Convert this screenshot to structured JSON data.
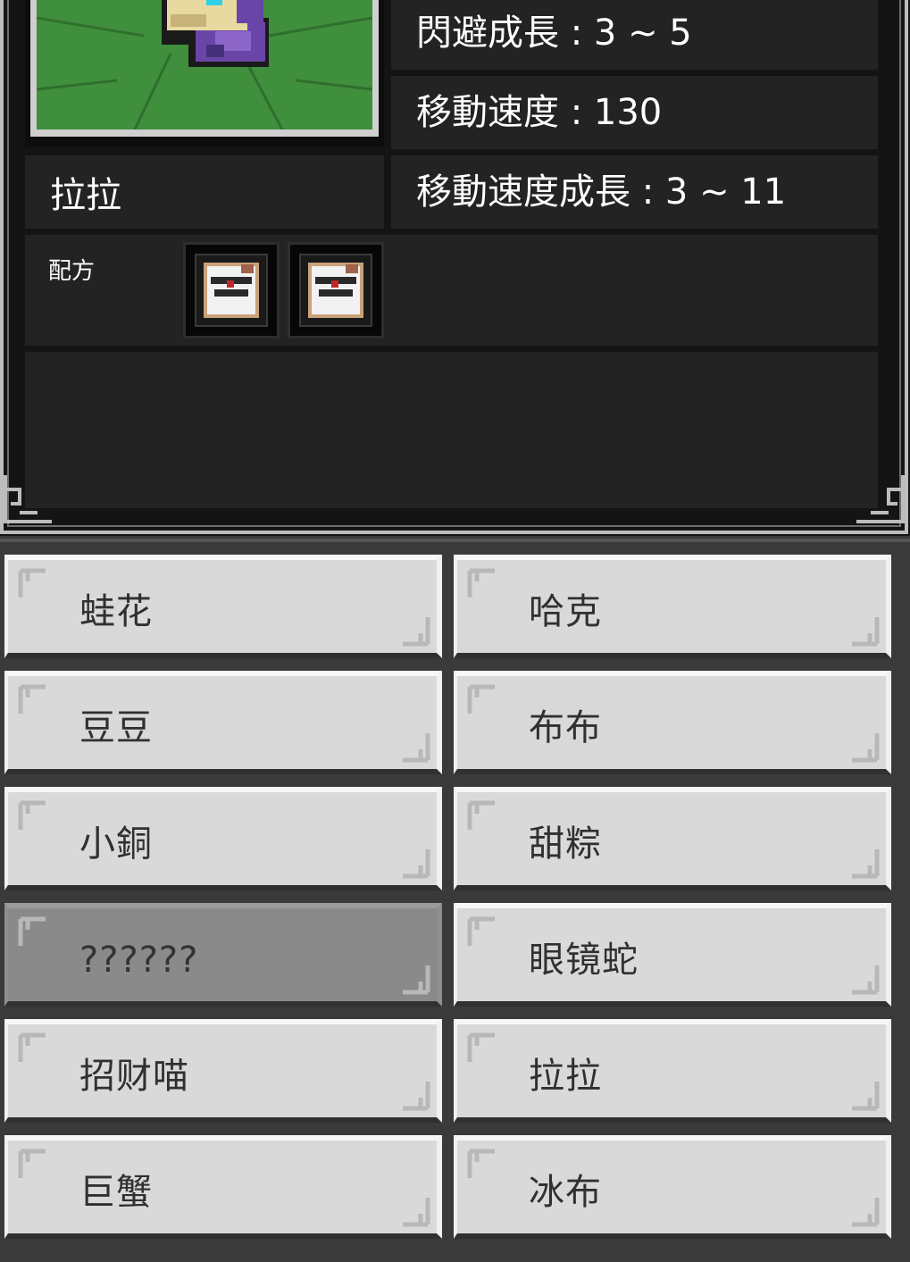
{
  "detail": {
    "stats": {
      "dodge_growth": "閃避成長 : 3 ~ 5",
      "move_speed": "移動速度 : 130",
      "move_speed_growth": "移動速度成長 : 3 ~ 11"
    },
    "pet_name": "拉拉",
    "recipe_label": "配方",
    "recipe_items": [
      "recipe-scroll-icon",
      "recipe-scroll-icon"
    ]
  },
  "pet_list": [
    {
      "label": "蛙花",
      "disabled": false
    },
    {
      "label": "哈克",
      "disabled": false
    },
    {
      "label": "豆豆",
      "disabled": false
    },
    {
      "label": "布布",
      "disabled": false
    },
    {
      "label": "小銅",
      "disabled": false
    },
    {
      "label": "甜粽",
      "disabled": false
    },
    {
      "label": "??????",
      "disabled": true
    },
    {
      "label": "眼镜蛇",
      "disabled": false
    },
    {
      "label": "招财喵",
      "disabled": false
    },
    {
      "label": "拉拉",
      "disabled": false
    },
    {
      "label": "巨蟹",
      "disabled": false
    },
    {
      "label": "冰布",
      "disabled": false
    }
  ],
  "colors": {
    "panel_bg": "#141414",
    "cell_bg": "#232323",
    "button_bg": "#d9d9d9",
    "button_disabled_bg": "#8a8a8a",
    "grass": "#3f8f3d"
  }
}
